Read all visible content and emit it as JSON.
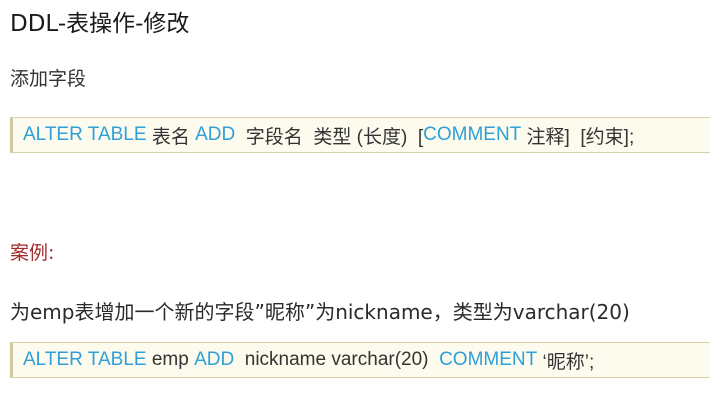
{
  "title": "DDL-表操作-修改",
  "section": "添加字段",
  "syntax": {
    "kw_alter_table": "ALTER TABLE",
    "table_name": " 表名 ",
    "kw_add": "ADD",
    "rest1": "  字段名  类型 (长度)  [",
    "kw_comment": "COMMENT",
    "rest2": " 注释]  [约束];"
  },
  "case_heading": "案例:",
  "case_desc": "为emp表增加一个新的字段”昵称”为nickname，类型为varchar(20)",
  "example": {
    "kw_alter_table": "ALTER TABLE",
    "table_name": " emp ",
    "kw_add": "ADD",
    "column_def": "  nickname varchar(20)  ",
    "kw_comment": "COMMENT",
    "comment_value": " ‘昵称’;"
  },
  "colors": {
    "keyword": "#2f9fd9",
    "case_heading": "#a52a2a",
    "code_background": "#fdfbee"
  }
}
